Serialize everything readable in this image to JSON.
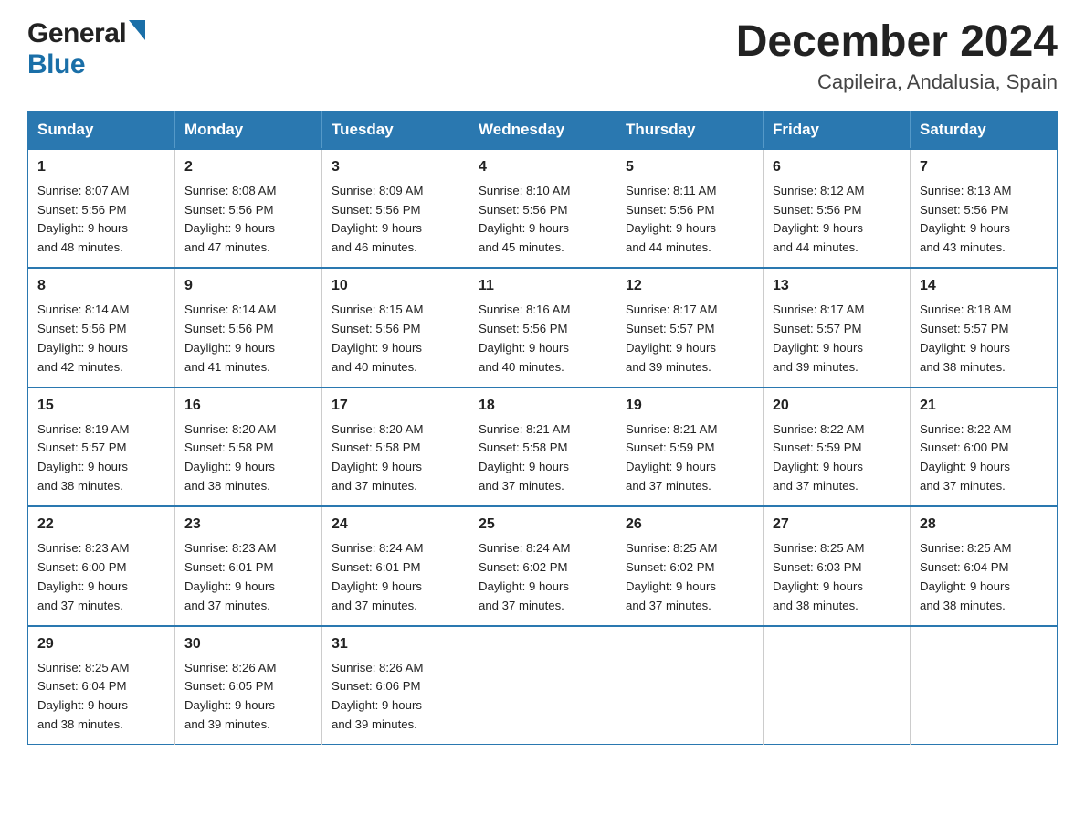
{
  "header": {
    "logo_general": "General",
    "logo_blue": "Blue",
    "title": "December 2024",
    "subtitle": "Capileira, Andalusia, Spain"
  },
  "days_of_week": [
    "Sunday",
    "Monday",
    "Tuesday",
    "Wednesday",
    "Thursday",
    "Friday",
    "Saturday"
  ],
  "weeks": [
    [
      {
        "day": "1",
        "sunrise": "8:07 AM",
        "sunset": "5:56 PM",
        "daylight": "9 hours and 48 minutes."
      },
      {
        "day": "2",
        "sunrise": "8:08 AM",
        "sunset": "5:56 PM",
        "daylight": "9 hours and 47 minutes."
      },
      {
        "day": "3",
        "sunrise": "8:09 AM",
        "sunset": "5:56 PM",
        "daylight": "9 hours and 46 minutes."
      },
      {
        "day": "4",
        "sunrise": "8:10 AM",
        "sunset": "5:56 PM",
        "daylight": "9 hours and 45 minutes."
      },
      {
        "day": "5",
        "sunrise": "8:11 AM",
        "sunset": "5:56 PM",
        "daylight": "9 hours and 44 minutes."
      },
      {
        "day": "6",
        "sunrise": "8:12 AM",
        "sunset": "5:56 PM",
        "daylight": "9 hours and 44 minutes."
      },
      {
        "day": "7",
        "sunrise": "8:13 AM",
        "sunset": "5:56 PM",
        "daylight": "9 hours and 43 minutes."
      }
    ],
    [
      {
        "day": "8",
        "sunrise": "8:14 AM",
        "sunset": "5:56 PM",
        "daylight": "9 hours and 42 minutes."
      },
      {
        "day": "9",
        "sunrise": "8:14 AM",
        "sunset": "5:56 PM",
        "daylight": "9 hours and 41 minutes."
      },
      {
        "day": "10",
        "sunrise": "8:15 AM",
        "sunset": "5:56 PM",
        "daylight": "9 hours and 40 minutes."
      },
      {
        "day": "11",
        "sunrise": "8:16 AM",
        "sunset": "5:56 PM",
        "daylight": "9 hours and 40 minutes."
      },
      {
        "day": "12",
        "sunrise": "8:17 AM",
        "sunset": "5:57 PM",
        "daylight": "9 hours and 39 minutes."
      },
      {
        "day": "13",
        "sunrise": "8:17 AM",
        "sunset": "5:57 PM",
        "daylight": "9 hours and 39 minutes."
      },
      {
        "day": "14",
        "sunrise": "8:18 AM",
        "sunset": "5:57 PM",
        "daylight": "9 hours and 38 minutes."
      }
    ],
    [
      {
        "day": "15",
        "sunrise": "8:19 AM",
        "sunset": "5:57 PM",
        "daylight": "9 hours and 38 minutes."
      },
      {
        "day": "16",
        "sunrise": "8:20 AM",
        "sunset": "5:58 PM",
        "daylight": "9 hours and 38 minutes."
      },
      {
        "day": "17",
        "sunrise": "8:20 AM",
        "sunset": "5:58 PM",
        "daylight": "9 hours and 37 minutes."
      },
      {
        "day": "18",
        "sunrise": "8:21 AM",
        "sunset": "5:58 PM",
        "daylight": "9 hours and 37 minutes."
      },
      {
        "day": "19",
        "sunrise": "8:21 AM",
        "sunset": "5:59 PM",
        "daylight": "9 hours and 37 minutes."
      },
      {
        "day": "20",
        "sunrise": "8:22 AM",
        "sunset": "5:59 PM",
        "daylight": "9 hours and 37 minutes."
      },
      {
        "day": "21",
        "sunrise": "8:22 AM",
        "sunset": "6:00 PM",
        "daylight": "9 hours and 37 minutes."
      }
    ],
    [
      {
        "day": "22",
        "sunrise": "8:23 AM",
        "sunset": "6:00 PM",
        "daylight": "9 hours and 37 minutes."
      },
      {
        "day": "23",
        "sunrise": "8:23 AM",
        "sunset": "6:01 PM",
        "daylight": "9 hours and 37 minutes."
      },
      {
        "day": "24",
        "sunrise": "8:24 AM",
        "sunset": "6:01 PM",
        "daylight": "9 hours and 37 minutes."
      },
      {
        "day": "25",
        "sunrise": "8:24 AM",
        "sunset": "6:02 PM",
        "daylight": "9 hours and 37 minutes."
      },
      {
        "day": "26",
        "sunrise": "8:25 AM",
        "sunset": "6:02 PM",
        "daylight": "9 hours and 37 minutes."
      },
      {
        "day": "27",
        "sunrise": "8:25 AM",
        "sunset": "6:03 PM",
        "daylight": "9 hours and 38 minutes."
      },
      {
        "day": "28",
        "sunrise": "8:25 AM",
        "sunset": "6:04 PM",
        "daylight": "9 hours and 38 minutes."
      }
    ],
    [
      {
        "day": "29",
        "sunrise": "8:25 AM",
        "sunset": "6:04 PM",
        "daylight": "9 hours and 38 minutes."
      },
      {
        "day": "30",
        "sunrise": "8:26 AM",
        "sunset": "6:05 PM",
        "daylight": "9 hours and 39 minutes."
      },
      {
        "day": "31",
        "sunrise": "8:26 AM",
        "sunset": "6:06 PM",
        "daylight": "9 hours and 39 minutes."
      },
      null,
      null,
      null,
      null
    ]
  ],
  "labels": {
    "sunrise": "Sunrise:",
    "sunset": "Sunset:",
    "daylight": "Daylight:"
  }
}
